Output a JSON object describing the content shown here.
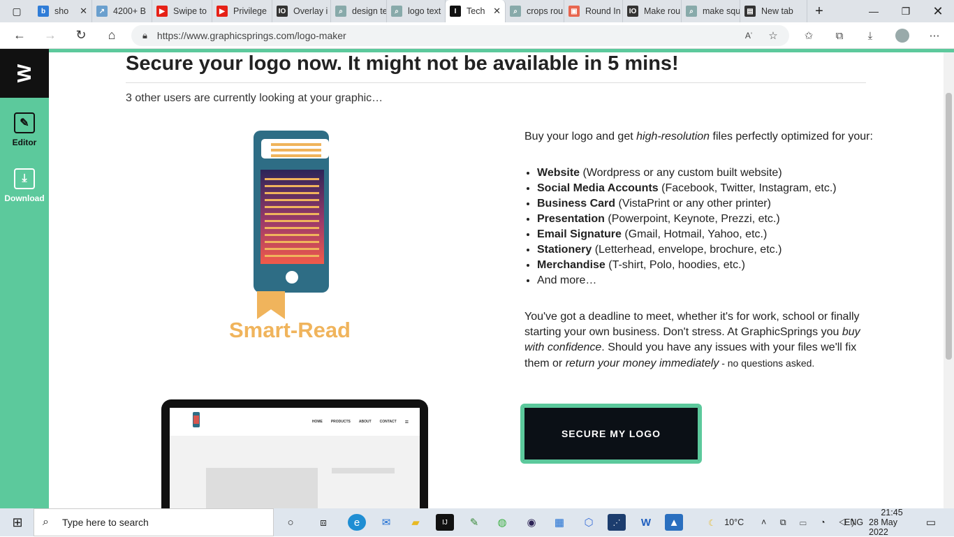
{
  "browser": {
    "tabs": [
      {
        "label": "sho",
        "fav": "b",
        "color": "#2f7cd7"
      },
      {
        "label": "4200+ B",
        "fav": "↗",
        "color": "#6a9fce"
      },
      {
        "label": "Swipe to",
        "fav": "▶",
        "color": "#e62117"
      },
      {
        "label": "Privilege",
        "fav": "▶",
        "color": "#e62117"
      },
      {
        "label": "Overlay i",
        "fav": "IO",
        "color": "#333"
      },
      {
        "label": "design te",
        "fav": "⌕",
        "color": "#8aa"
      },
      {
        "label": "logo text",
        "fav": "⌕",
        "color": "#8aa"
      },
      {
        "label": "Tech",
        "fav": "I",
        "color": "#111"
      },
      {
        "label": "crops rou",
        "fav": "⌕",
        "color": "#8aa"
      },
      {
        "label": "Round In",
        "fav": "▣",
        "color": "#e8664f"
      },
      {
        "label": "Make rou",
        "fav": "IO",
        "color": "#333"
      },
      {
        "label": "make squ",
        "fav": "⌕",
        "color": "#8aa"
      },
      {
        "label": "New tab",
        "fav": "▤",
        "color": "#333"
      }
    ],
    "url": "https://www.graphicsprings.com/logo-maker"
  },
  "sidebar": {
    "logo": "W",
    "items": [
      {
        "label": "Editor",
        "icon": "edit-icon"
      },
      {
        "label": "Download",
        "icon": "download-icon"
      }
    ]
  },
  "page": {
    "headline": "Secure your logo now. It might not be available in 5 mins!",
    "subline": "3 other users are currently looking at your graphic…",
    "intro_a": "Buy your logo and get ",
    "intro_em": "high-resolution",
    "intro_b": " files perfectly optimized for your:",
    "features": [
      {
        "bold": "Website",
        "rest": " (Wordpress or any custom built website)"
      },
      {
        "bold": "Social Media Accounts",
        "rest": " (Facebook, Twitter, Instagram, etc.)"
      },
      {
        "bold": "Business Card",
        "rest": " (VistaPrint or any other printer)"
      },
      {
        "bold": "Presentation",
        "rest": " (Powerpoint, Keynote, Prezzi, etc.)"
      },
      {
        "bold": "Email Signature",
        "rest": " (Gmail, Hotmail, Yahoo, etc.)"
      },
      {
        "bold": "Stationery",
        "rest": " (Letterhead, envelope, brochure, etc.)"
      },
      {
        "bold": "Merchandise",
        "rest": " (T-shirt, Polo, hoodies, etc.)"
      },
      {
        "bold": "",
        "rest": "And more…"
      }
    ],
    "deadline_a": "You've got a deadline to meet, whether it's for work, school or finally starting your own business. Don't stress. At GraphicSprings you ",
    "deadline_em1": "buy with confidence",
    "deadline_b": ". Should you have any issues with your files we'll fix them or ",
    "deadline_em2": "return your money immediately",
    "deadline_c": " - no questions asked.",
    "cta": "SECURE MY LOGO",
    "logo_name": "Smart-Read",
    "mockup_nav": [
      "HOME",
      "PRODUCTS",
      "ABOUT",
      "CONTACT"
    ]
  },
  "taskbar": {
    "search_placeholder": "Type here to search",
    "weather": "10°C",
    "lang": "ENG",
    "time": "21:45",
    "date": "28 May 2022"
  }
}
